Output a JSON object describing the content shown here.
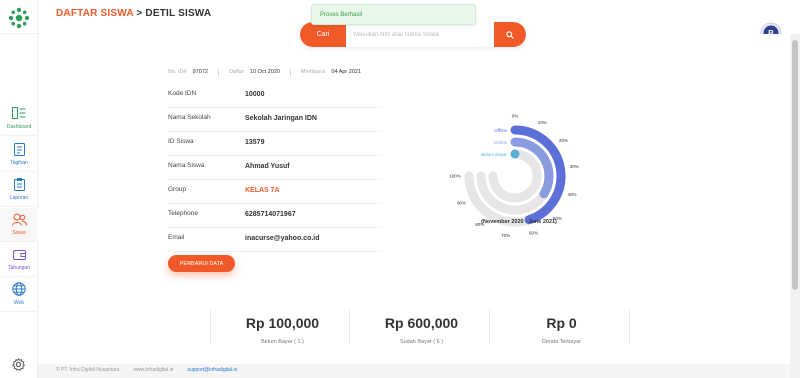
{
  "sidebar": {
    "items": [
      {
        "label": "Dashboard",
        "icon": "dashboard-icon"
      },
      {
        "label": "Tagihan",
        "icon": "bill-icon"
      },
      {
        "label": "Laporan",
        "icon": "report-icon"
      },
      {
        "label": "Siswa",
        "icon": "students-icon"
      },
      {
        "label": "Tabungan",
        "icon": "wallet-icon"
      },
      {
        "label": "Web",
        "icon": "globe-icon"
      }
    ],
    "active": "Siswa"
  },
  "header": {
    "breadcrumb_link": "DAFTAR SISWA",
    "breadcrumb_sep": " > ",
    "breadcrumb_current": "DETIL SISWA",
    "badge_letter": "B"
  },
  "toast": {
    "message": "Proses Berhasil"
  },
  "search": {
    "button_label": "Cari",
    "placeholder": "Masukan NIS atau Nama Siswa"
  },
  "meta": {
    "id_label": "No. ID#",
    "id_value": "97072",
    "date_label": "Daftar",
    "date_value": "10 Oct 2020",
    "updated_label": "Membarui",
    "updated_value": "04 Apr 2021"
  },
  "details": [
    {
      "key": "Kode IDN",
      "value": "10000"
    },
    {
      "key": "Nama Sekolah",
      "value": "Sekolah Jaringan IDN"
    },
    {
      "key": "ID Siswa",
      "value": "13579"
    },
    {
      "key": "Nama Siswa",
      "value": "Ahmad Yusuf"
    },
    {
      "key": "Group",
      "value": "KELAS 7A"
    },
    {
      "key": "Telephone",
      "value": "6285714071967"
    },
    {
      "key": "Email",
      "value": "inacurse@yahoo.co.id"
    }
  ],
  "update_button": "PERBARUI DATA",
  "chart_data": {
    "type": "radial-bar",
    "series": [
      {
        "name": "Offline",
        "value": 60,
        "color": "#5b6fd6"
      },
      {
        "name": "Online",
        "value": 45,
        "color": "#8a9be0"
      },
      {
        "name": "Belum Bayar",
        "value": 0,
        "color": "#5aaedb"
      }
    ],
    "ticks": [
      "0%",
      "10%",
      "20%",
      "30%",
      "40%",
      "50%",
      "60%",
      "70%",
      "80%",
      "90%",
      "100%"
    ],
    "max": 100,
    "track_color": "#e6e6e6",
    "caption": "(November 2020 - June 2021)"
  },
  "summary": [
    {
      "amount": "Rp 100,000",
      "label": "Belum Bayar ( 1 )"
    },
    {
      "amount": "Rp 600,000",
      "label": "Sudah Bayar ( 6 )"
    },
    {
      "amount": "Rp 0",
      "label": "Denda Terbayar"
    }
  ],
  "footer": {
    "copyright": "© PT. Infra Digital Nusantara",
    "website": "www.infradigital.io",
    "email": "support@infradigital.io"
  }
}
